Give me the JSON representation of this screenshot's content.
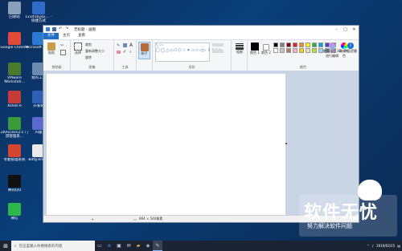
{
  "desktop": {
    "icons": [
      {
        "label": "回收站",
        "color": "#8aa0b8"
      },
      {
        "label": "123456ysp.... - 快捷方式",
        "color": "#2f6cc7"
      },
      {
        "label": "Google Chrome",
        "color": "#e04a3a"
      },
      {
        "label": "Microsoft Edge",
        "color": "#2a7bd4"
      },
      {
        "label": "VMware Workstati...",
        "color": "#4a7a2e"
      },
      {
        "label": "我的工具",
        "color": "#6a8ab0"
      },
      {
        "label": "Xshell 6",
        "color": "#c73a3a"
      },
      {
        "label": "开发域",
        "color": "#2d5fb5"
      },
      {
        "label": "ZKAccess3.5 门禁管理系...",
        "color": "#3a9a3a"
      },
      {
        "label": "Ai版",
        "color": "#5a6ad0"
      },
      {
        "label": "考勤管理系统",
        "color": "#d4472e"
      },
      {
        "label": "Bdfg-ern33",
        "color": "#eaeaea"
      },
      {
        "label": "腾讯QQ",
        "color": "#111111"
      },
      {
        "label": "微信",
        "color": "#2db64a"
      }
    ]
  },
  "paint": {
    "title": "无标题 - 画图",
    "tabs": [
      "文件",
      "主页",
      "查看"
    ],
    "groups": [
      {
        "name": "clipboard",
        "label": "剪贴板",
        "buttons": [
          "粘贴"
        ]
      },
      {
        "name": "image",
        "label": "图像",
        "buttons": [
          "选择",
          "裁剪",
          "重新调整大小",
          "旋转"
        ]
      },
      {
        "name": "tools",
        "label": "工具",
        "buttons": []
      },
      {
        "name": "brushes",
        "label": "",
        "buttons": [
          "刷子"
        ]
      },
      {
        "name": "shapes",
        "label": "形状",
        "buttons": []
      },
      {
        "name": "size",
        "label": "",
        "buttons": [
          "粗细"
        ]
      },
      {
        "name": "colors",
        "label": "颜色",
        "buttons": [
          "颜色 1",
          "颜色 2",
          "编辑颜色",
          "使用画图 3D 进行编辑",
          "产品提醒"
        ]
      }
    ],
    "palette": [
      "#000000",
      "#7f7f7f",
      "#880015",
      "#ed1c24",
      "#ff7f27",
      "#fff200",
      "#22b14c",
      "#00a2e8",
      "#3f48cc",
      "#a349a4",
      "#ffffff",
      "#c3c3c3",
      "#b97a57",
      "#ffaec9",
      "#ffc90e",
      "#efe4b0",
      "#b5e61d",
      "#99d9ea",
      "#7092be",
      "#c8bfe7"
    ],
    "status": {
      "size": "864 × 540像素"
    }
  },
  "taskbar": {
    "search_placeholder": "在这里输入你要搜索的内容",
    "date": "2019/02/15"
  },
  "watermark": {
    "big": "软件无忧",
    "small": "努力解决软件问题"
  }
}
